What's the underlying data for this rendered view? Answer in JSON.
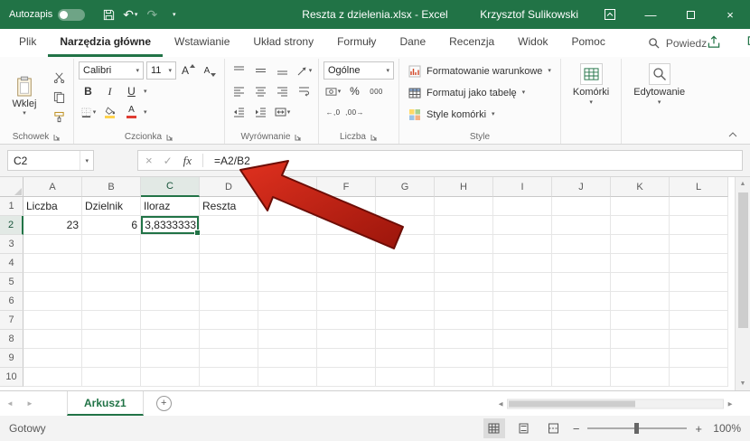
{
  "titlebar": {
    "autosave_label": "Autozapis",
    "title": "Reszta z dzielenia.xlsx  -  Excel",
    "user_name": "Krzysztof Sulikowski"
  },
  "glyphs": {
    "caret": "▾",
    "undo": "↶",
    "redo": "↷",
    "minimize": "—",
    "close": "×",
    "cancel": "×",
    "enter": "✓",
    "fx": "fx",
    "bold": "B",
    "italic": "I",
    "underline": "U",
    "letter_a": "A",
    "percent": "%",
    "thousands": "000",
    "increase_decimal": "←,0",
    "decrease_decimal": ",00→",
    "scroll_up": "▲",
    "scroll_down": "▼",
    "scroll_left": "◄",
    "scroll_right": "►",
    "zoom_out": "−",
    "zoom_in": "+",
    "add_sheet": "+"
  },
  "ribbon": {
    "tabs": [
      {
        "key": "plik",
        "label": "Plik",
        "active": false
      },
      {
        "key": "narzedzia-glowne",
        "label": "Narzędzia główne",
        "active": true
      },
      {
        "key": "wstawianie",
        "label": "Wstawianie",
        "active": false
      },
      {
        "key": "uklad-strony",
        "label": "Układ strony",
        "active": false
      },
      {
        "key": "formuly",
        "label": "Formuły",
        "active": false
      },
      {
        "key": "dane",
        "label": "Dane",
        "active": false
      },
      {
        "key": "recenzja",
        "label": "Recenzja",
        "active": false
      },
      {
        "key": "widok",
        "label": "Widok",
        "active": false
      },
      {
        "key": "pomoc",
        "label": "Pomoc",
        "active": false
      }
    ],
    "tell_me": "Powiedz",
    "paste_label": "Wklej",
    "font_name": "Calibri",
    "font_size": "11",
    "number_format": "Ogólne",
    "style_buttons": [
      "Formatowanie warunkowe",
      "Formatuj jako tabelę",
      "Style komórki"
    ],
    "cells_label": "Komórki",
    "editing_label": "Edytowanie",
    "groups": {
      "clipboard": "Schowek",
      "font": "Czcionka",
      "alignment": "Wyrównanie",
      "number": "Liczba",
      "styles": "Style"
    }
  },
  "formula_bar": {
    "name_box": "C2",
    "formula": "=A2/B2"
  },
  "grid": {
    "columns": [
      "A",
      "B",
      "C",
      "D",
      "E",
      "F",
      "G",
      "H",
      "I",
      "J",
      "K",
      "L"
    ],
    "row_count": 10,
    "selected": {
      "cell": "C2",
      "column": "C",
      "row": "2"
    },
    "cells": {
      "A1": {
        "v": "Liczba",
        "align": "left"
      },
      "B1": {
        "v": "Dzielnik",
        "align": "left"
      },
      "C1": {
        "v": "Iloraz",
        "align": "left"
      },
      "D1": {
        "v": "Reszta",
        "align": "left"
      },
      "A2": {
        "v": "23",
        "align": "right"
      },
      "B2": {
        "v": "6",
        "align": "right"
      },
      "C2": {
        "v": "3,8333333",
        "align": "right"
      }
    }
  },
  "sheet_bar": {
    "sheet_name": "Arkusz1"
  },
  "status_bar": {
    "status": "Gotowy",
    "zoom_level": "100%"
  },
  "colors": {
    "excel_green": "#217346",
    "arrow_red": "#c0170c"
  }
}
